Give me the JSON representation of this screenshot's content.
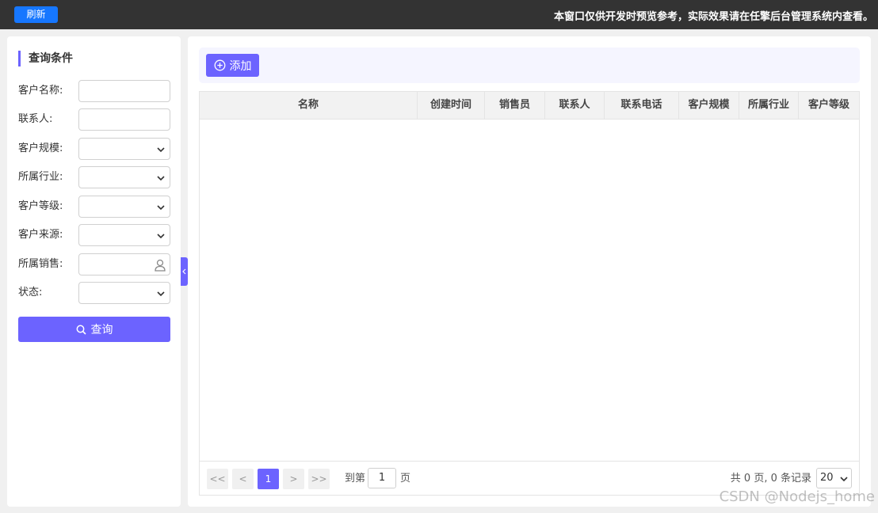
{
  "topbar": {
    "refresh_label": "刷新",
    "notice": "本窗口仅供开发时预览参考，实际效果请在任擎后台管理系统内查看。"
  },
  "filter": {
    "title": "查询条件",
    "fields": [
      {
        "label": "客户名称:",
        "type": "text",
        "value": ""
      },
      {
        "label": "联系人:",
        "type": "text",
        "value": ""
      },
      {
        "label": "客户规模:",
        "type": "select",
        "value": ""
      },
      {
        "label": "所属行业:",
        "type": "select",
        "value": ""
      },
      {
        "label": "客户等级:",
        "type": "select",
        "value": ""
      },
      {
        "label": "客户来源:",
        "type": "select",
        "value": ""
      },
      {
        "label": "所属销售:",
        "type": "user-picker",
        "value": ""
      },
      {
        "label": "状态:",
        "type": "select",
        "value": ""
      }
    ],
    "query_label": "查询"
  },
  "toolbar": {
    "add_label": "添加"
  },
  "table": {
    "columns": [
      "名称",
      "创建时间",
      "销售员",
      "联系人",
      "联系电话",
      "客户规模",
      "所属行业",
      "客户等级"
    ],
    "rows": []
  },
  "pagination": {
    "first": "<<",
    "prev": "<",
    "current": "1",
    "next": ">",
    "last": ">>",
    "goto_prefix": "到第",
    "goto_value": "1",
    "goto_suffix": "页",
    "summary": "共 0 页, 0 条记录",
    "page_size": "20"
  },
  "watermark": "CSDN @Nodejs_home",
  "colors": {
    "accent": "#6c63ff",
    "refresh": "#1677ff",
    "topbar": "#333333"
  }
}
